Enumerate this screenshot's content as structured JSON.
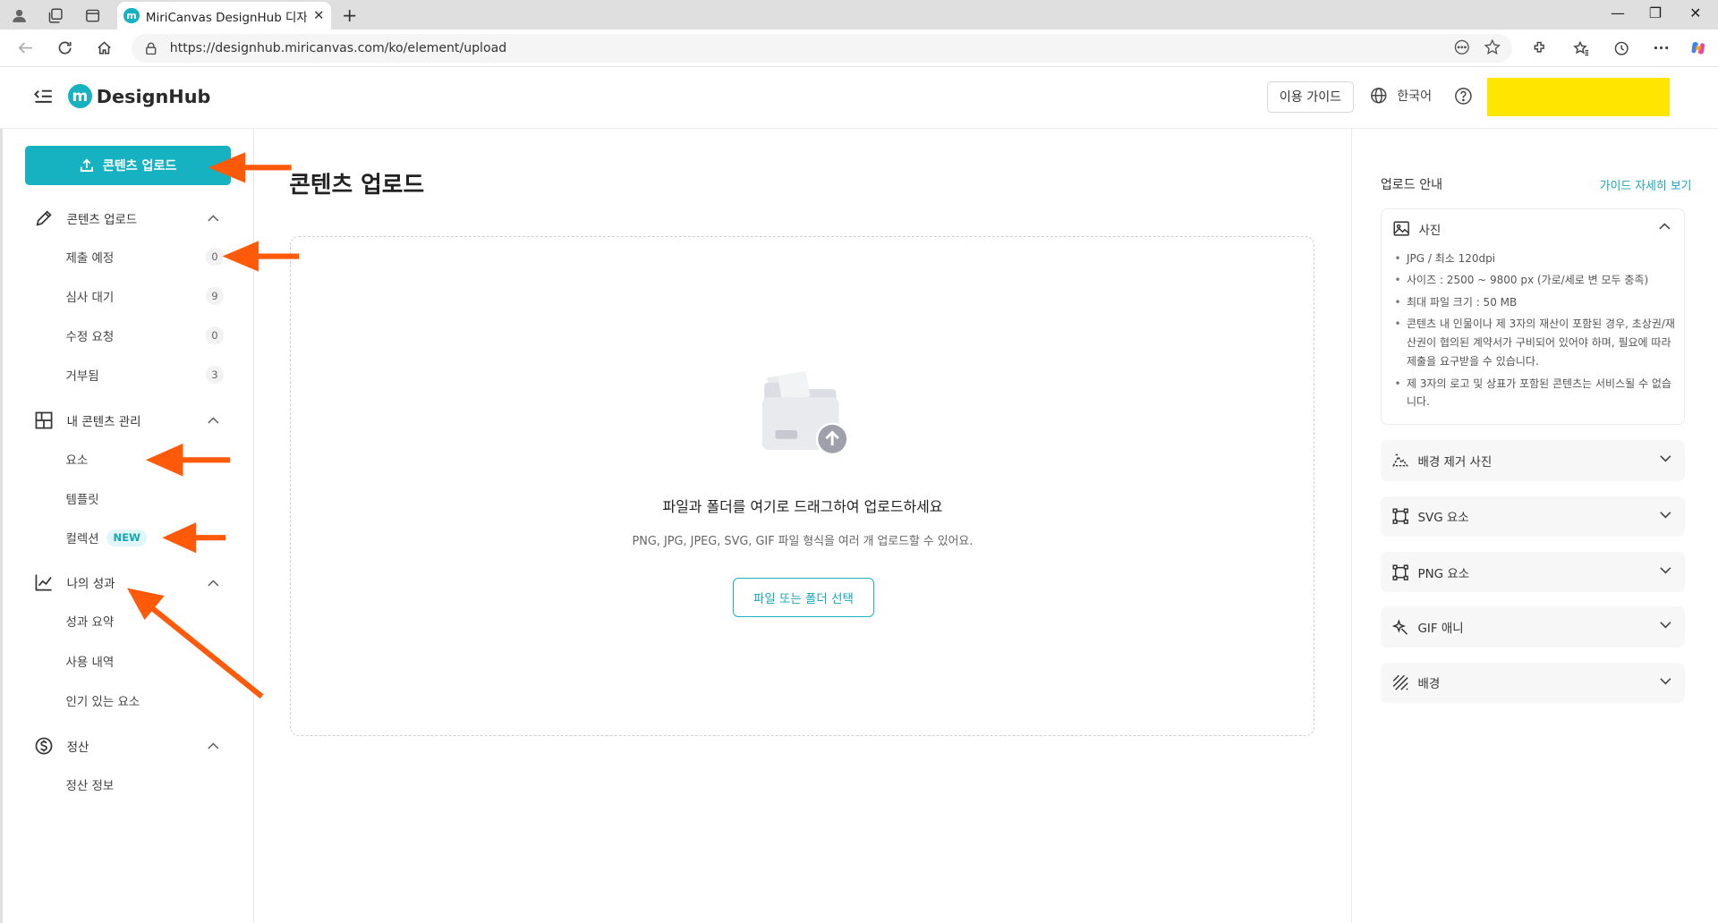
{
  "browser": {
    "tab_title": "MiriCanvas DesignHub 디자인허브",
    "url": "https://designhub.miricanvas.com/ko/element/upload"
  },
  "header": {
    "logo_text": "DesignHub",
    "guide_button": "이용 가이드",
    "language": "한국어"
  },
  "sidebar": {
    "upload_button": "콘텐츠 업로드",
    "sections": [
      {
        "label": "콘텐츠 업로드",
        "icon": "pencil-icon",
        "items": [
          {
            "label": "제출 예정",
            "count": "0"
          },
          {
            "label": "심사 대기",
            "count": "9"
          },
          {
            "label": "수정 요청",
            "count": "0"
          },
          {
            "label": "거부됨",
            "count": "3"
          }
        ]
      },
      {
        "label": "내 콘텐츠 관리",
        "icon": "grid-icon",
        "items": [
          {
            "label": "요소"
          },
          {
            "label": "템플릿"
          },
          {
            "label": "컬렉션",
            "badge": "NEW"
          }
        ]
      },
      {
        "label": "나의 성과",
        "icon": "chart-icon",
        "items": [
          {
            "label": "성과 요약"
          },
          {
            "label": "사용 내역"
          },
          {
            "label": "인기 있는 요소"
          }
        ]
      },
      {
        "label": "정산",
        "icon": "dollar-icon",
        "items": [
          {
            "label": "정산 정보"
          }
        ]
      }
    ]
  },
  "main": {
    "title": "콘텐츠 업로드",
    "dropzone_text": "파일과 폴더를 여기로 드래그하여 업로드하세요",
    "dropzone_subtext": "PNG, JPG, JPEG, SVG, GIF 파일 형식을 여러 개 업로드할 수 있어요.",
    "select_button": "파일 또는 폴더 선택"
  },
  "guide": {
    "title": "업로드 안내",
    "detail_link": "가이드 자세히 보기",
    "photo": {
      "label": "사진",
      "rules": [
        "JPG / 최소 120dpi",
        "사이즈 : 2500 ~ 9800 px (가로/세로 변 모두 충족)",
        "최대 파일 크기 : 50 MB",
        "콘텐츠 내 인물이나 제 3자의 재산이 포함된 경우, 초상권/재산권이 협의된 계약서가 구비되어 있어야 하며, 필요에 따라 제출을 요구받을 수 있습니다.",
        "제 3자의 로고 및 상표가 포함된 콘텐츠는 서비스될 수 없습니다."
      ]
    },
    "sections": [
      {
        "label": "배경 제거 사진",
        "icon": "mountain-cut-icon"
      },
      {
        "label": "SVG 요소",
        "icon": "vector-square-icon"
      },
      {
        "label": "PNG 요소",
        "icon": "vector-square-icon"
      },
      {
        "label": "GIF 애니",
        "icon": "sparkle-icon"
      },
      {
        "label": "배경",
        "icon": "hatch-icon"
      }
    ]
  },
  "colors": {
    "accent": "#16b2c2",
    "annotation_arrow": "#ff5a0a",
    "highlight": "#ffe600"
  }
}
